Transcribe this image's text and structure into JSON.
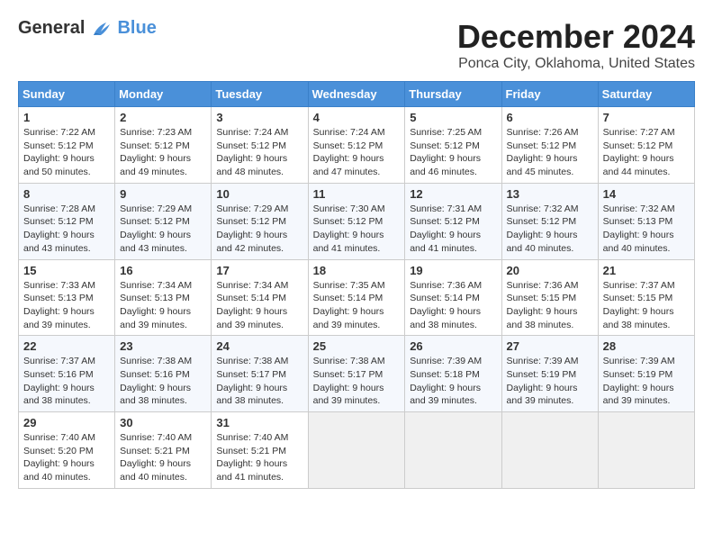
{
  "header": {
    "logo_general": "General",
    "logo_blue": "Blue",
    "month_title": "December 2024",
    "location": "Ponca City, Oklahoma, United States"
  },
  "weekdays": [
    "Sunday",
    "Monday",
    "Tuesday",
    "Wednesday",
    "Thursday",
    "Friday",
    "Saturday"
  ],
  "weeks": [
    [
      {
        "day": "1",
        "sunrise": "Sunrise: 7:22 AM",
        "sunset": "Sunset: 5:12 PM",
        "daylight": "Daylight: 9 hours and 50 minutes."
      },
      {
        "day": "2",
        "sunrise": "Sunrise: 7:23 AM",
        "sunset": "Sunset: 5:12 PM",
        "daylight": "Daylight: 9 hours and 49 minutes."
      },
      {
        "day": "3",
        "sunrise": "Sunrise: 7:24 AM",
        "sunset": "Sunset: 5:12 PM",
        "daylight": "Daylight: 9 hours and 48 minutes."
      },
      {
        "day": "4",
        "sunrise": "Sunrise: 7:24 AM",
        "sunset": "Sunset: 5:12 PM",
        "daylight": "Daylight: 9 hours and 47 minutes."
      },
      {
        "day": "5",
        "sunrise": "Sunrise: 7:25 AM",
        "sunset": "Sunset: 5:12 PM",
        "daylight": "Daylight: 9 hours and 46 minutes."
      },
      {
        "day": "6",
        "sunrise": "Sunrise: 7:26 AM",
        "sunset": "Sunset: 5:12 PM",
        "daylight": "Daylight: 9 hours and 45 minutes."
      },
      {
        "day": "7",
        "sunrise": "Sunrise: 7:27 AM",
        "sunset": "Sunset: 5:12 PM",
        "daylight": "Daylight: 9 hours and 44 minutes."
      }
    ],
    [
      {
        "day": "8",
        "sunrise": "Sunrise: 7:28 AM",
        "sunset": "Sunset: 5:12 PM",
        "daylight": "Daylight: 9 hours and 43 minutes."
      },
      {
        "day": "9",
        "sunrise": "Sunrise: 7:29 AM",
        "sunset": "Sunset: 5:12 PM",
        "daylight": "Daylight: 9 hours and 43 minutes."
      },
      {
        "day": "10",
        "sunrise": "Sunrise: 7:29 AM",
        "sunset": "Sunset: 5:12 PM",
        "daylight": "Daylight: 9 hours and 42 minutes."
      },
      {
        "day": "11",
        "sunrise": "Sunrise: 7:30 AM",
        "sunset": "Sunset: 5:12 PM",
        "daylight": "Daylight: 9 hours and 41 minutes."
      },
      {
        "day": "12",
        "sunrise": "Sunrise: 7:31 AM",
        "sunset": "Sunset: 5:12 PM",
        "daylight": "Daylight: 9 hours and 41 minutes."
      },
      {
        "day": "13",
        "sunrise": "Sunrise: 7:32 AM",
        "sunset": "Sunset: 5:12 PM",
        "daylight": "Daylight: 9 hours and 40 minutes."
      },
      {
        "day": "14",
        "sunrise": "Sunrise: 7:32 AM",
        "sunset": "Sunset: 5:13 PM",
        "daylight": "Daylight: 9 hours and 40 minutes."
      }
    ],
    [
      {
        "day": "15",
        "sunrise": "Sunrise: 7:33 AM",
        "sunset": "Sunset: 5:13 PM",
        "daylight": "Daylight: 9 hours and 39 minutes."
      },
      {
        "day": "16",
        "sunrise": "Sunrise: 7:34 AM",
        "sunset": "Sunset: 5:13 PM",
        "daylight": "Daylight: 9 hours and 39 minutes."
      },
      {
        "day": "17",
        "sunrise": "Sunrise: 7:34 AM",
        "sunset": "Sunset: 5:14 PM",
        "daylight": "Daylight: 9 hours and 39 minutes."
      },
      {
        "day": "18",
        "sunrise": "Sunrise: 7:35 AM",
        "sunset": "Sunset: 5:14 PM",
        "daylight": "Daylight: 9 hours and 39 minutes."
      },
      {
        "day": "19",
        "sunrise": "Sunrise: 7:36 AM",
        "sunset": "Sunset: 5:14 PM",
        "daylight": "Daylight: 9 hours and 38 minutes."
      },
      {
        "day": "20",
        "sunrise": "Sunrise: 7:36 AM",
        "sunset": "Sunset: 5:15 PM",
        "daylight": "Daylight: 9 hours and 38 minutes."
      },
      {
        "day": "21",
        "sunrise": "Sunrise: 7:37 AM",
        "sunset": "Sunset: 5:15 PM",
        "daylight": "Daylight: 9 hours and 38 minutes."
      }
    ],
    [
      {
        "day": "22",
        "sunrise": "Sunrise: 7:37 AM",
        "sunset": "Sunset: 5:16 PM",
        "daylight": "Daylight: 9 hours and 38 minutes."
      },
      {
        "day": "23",
        "sunrise": "Sunrise: 7:38 AM",
        "sunset": "Sunset: 5:16 PM",
        "daylight": "Daylight: 9 hours and 38 minutes."
      },
      {
        "day": "24",
        "sunrise": "Sunrise: 7:38 AM",
        "sunset": "Sunset: 5:17 PM",
        "daylight": "Daylight: 9 hours and 38 minutes."
      },
      {
        "day": "25",
        "sunrise": "Sunrise: 7:38 AM",
        "sunset": "Sunset: 5:17 PM",
        "daylight": "Daylight: 9 hours and 39 minutes."
      },
      {
        "day": "26",
        "sunrise": "Sunrise: 7:39 AM",
        "sunset": "Sunset: 5:18 PM",
        "daylight": "Daylight: 9 hours and 39 minutes."
      },
      {
        "day": "27",
        "sunrise": "Sunrise: 7:39 AM",
        "sunset": "Sunset: 5:19 PM",
        "daylight": "Daylight: 9 hours and 39 minutes."
      },
      {
        "day": "28",
        "sunrise": "Sunrise: 7:39 AM",
        "sunset": "Sunset: 5:19 PM",
        "daylight": "Daylight: 9 hours and 39 minutes."
      }
    ],
    [
      {
        "day": "29",
        "sunrise": "Sunrise: 7:40 AM",
        "sunset": "Sunset: 5:20 PM",
        "daylight": "Daylight: 9 hours and 40 minutes."
      },
      {
        "day": "30",
        "sunrise": "Sunrise: 7:40 AM",
        "sunset": "Sunset: 5:21 PM",
        "daylight": "Daylight: 9 hours and 40 minutes."
      },
      {
        "day": "31",
        "sunrise": "Sunrise: 7:40 AM",
        "sunset": "Sunset: 5:21 PM",
        "daylight": "Daylight: 9 hours and 41 minutes."
      },
      null,
      null,
      null,
      null
    ]
  ]
}
